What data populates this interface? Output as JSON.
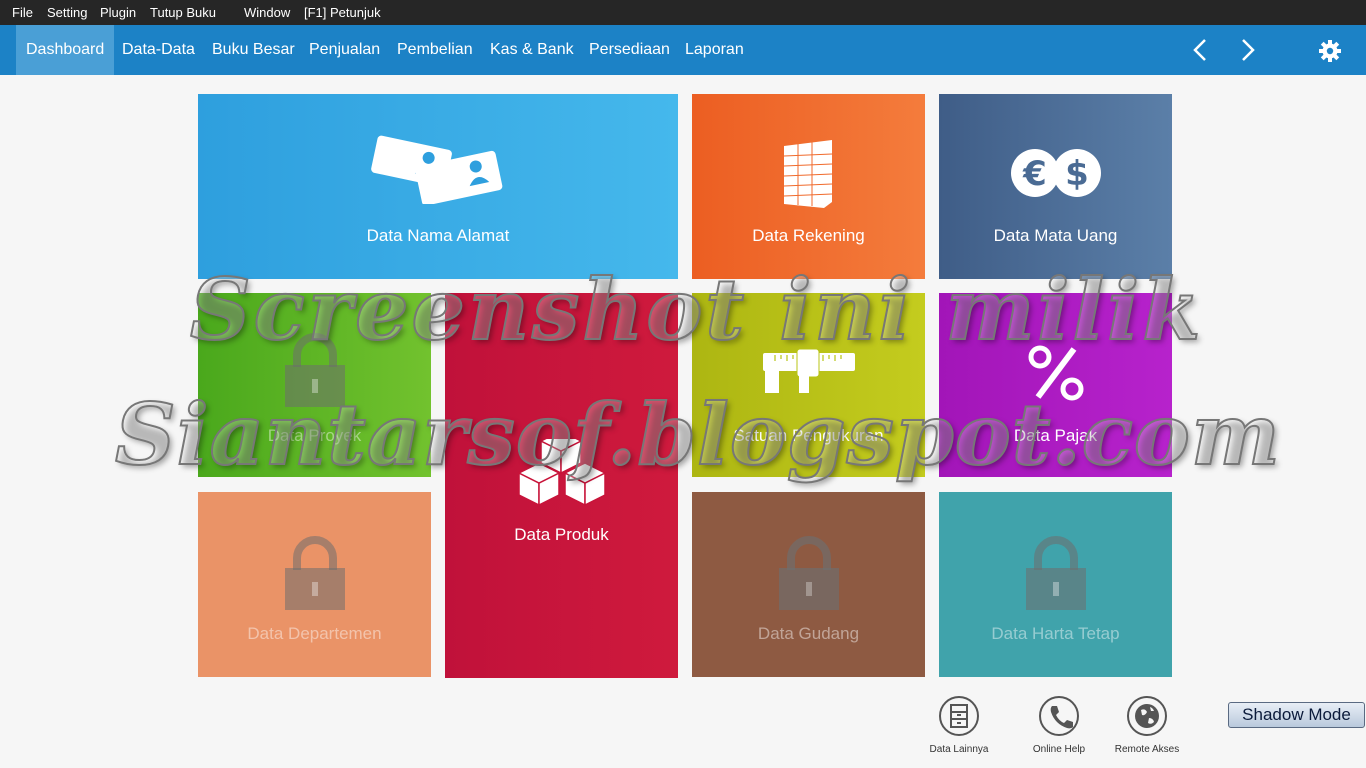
{
  "menubar": {
    "items": [
      "File",
      "Setting",
      "Plugin",
      "Tutup Buku",
      "Window",
      "[F1] Petunjuk"
    ]
  },
  "nav": {
    "tabs": [
      "Dashboard",
      "Data-Data",
      "Buku Besar",
      "Penjualan",
      "Pembelian",
      "Kas & Bank",
      "Persediaan",
      "Laporan"
    ],
    "active": "Dashboard",
    "bar_color": "#1c82c6"
  },
  "tiles": [
    {
      "label": "Data Nama Alamat",
      "icon": "address-cards-icon",
      "color": "#3aa8e2",
      "locked": false
    },
    {
      "label": "Data Rekening",
      "icon": "ledger-sheet-icon",
      "color": "#f06a2c",
      "locked": false
    },
    {
      "label": "Data Mata Uang",
      "icon": "currency-coins-icon",
      "color": "#4a6b94",
      "locked": false
    },
    {
      "label": "Data Proyek",
      "icon": "lock-icon",
      "color": "#5db72a",
      "locked": true
    },
    {
      "label": "Data Produk",
      "icon": "boxes-icon",
      "color": "#c8143a",
      "locked": false
    },
    {
      "label": "Satuan Pengukuran",
      "icon": "caliper-icon",
      "color": "#b8c414",
      "locked": false
    },
    {
      "label": "Data Pajak",
      "icon": "percent-icon",
      "color": "#ad1bc4",
      "locked": false
    },
    {
      "label": "Data Departemen",
      "icon": "lock-icon",
      "color": "#ea9367",
      "locked": true
    },
    {
      "label": "Data Gudang",
      "icon": "lock-icon",
      "color": "#8e5a42",
      "locked": true
    },
    {
      "label": "Data Harta Tetap",
      "icon": "lock-icon",
      "color": "#40a3ab",
      "locked": true
    }
  ],
  "bottom_buttons": [
    {
      "label": "Data Lainnya",
      "icon": "cabinet-icon"
    },
    {
      "label": "Online Help",
      "icon": "phone-icon"
    },
    {
      "label": "Remote Akses",
      "icon": "globe-icon"
    }
  ],
  "shadow_mode_label": "Shadow Mode",
  "watermark": {
    "line1": "Screenshot ini milik",
    "line2": "Siantarsof.blogspot.com"
  }
}
